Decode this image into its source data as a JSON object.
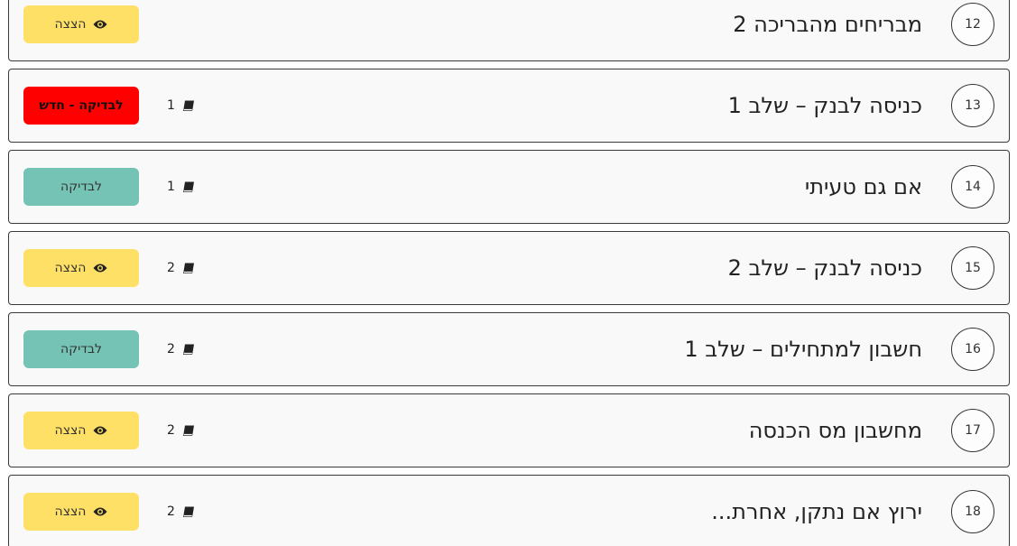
{
  "colors": {
    "view_button": "#ffe066",
    "check_button": "#74c3b5",
    "new_check_button": "#ff0000"
  },
  "rows": [
    {
      "number": "12",
      "title": "מבריחים מהבריכה 2",
      "count": "",
      "button": {
        "label": "הצצה",
        "kind": "view",
        "icon": "eye-icon"
      }
    },
    {
      "number": "13",
      "title": "כניסה לבנק – שלב 1",
      "count": "1",
      "button": {
        "label": "לבדיקה - חדש",
        "kind": "new",
        "icon": ""
      }
    },
    {
      "number": "14",
      "title": "אם גם טעיתי",
      "count": "1",
      "button": {
        "label": "לבדיקה",
        "kind": "check",
        "icon": ""
      }
    },
    {
      "number": "15",
      "title": "כניסה לבנק – שלב 2",
      "count": "2",
      "button": {
        "label": "הצצה",
        "kind": "view",
        "icon": "eye-icon"
      }
    },
    {
      "number": "16",
      "title": "חשבון למתחילים – שלב 1",
      "count": "2",
      "button": {
        "label": "לבדיקה",
        "kind": "check",
        "icon": ""
      }
    },
    {
      "number": "17",
      "title": "מחשבון מס הכנסה",
      "count": "2",
      "button": {
        "label": "הצצה",
        "kind": "view",
        "icon": "eye-icon"
      }
    },
    {
      "number": "18",
      "title": "ירוץ אם נתקן, אחרת...",
      "count": "2",
      "button": {
        "label": "הצצה",
        "kind": "view",
        "icon": "eye-icon"
      }
    }
  ]
}
